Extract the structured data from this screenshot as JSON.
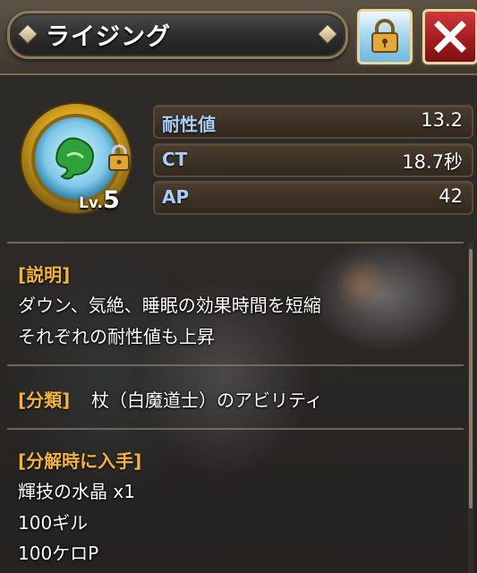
{
  "header": {
    "title": "ライジング"
  },
  "ability": {
    "level_prefix": "Lv.",
    "level": "5",
    "locked": true
  },
  "stats": [
    {
      "label": "耐性値",
      "value": "13.2"
    },
    {
      "label": "CT",
      "value": "18.7秒"
    },
    {
      "label": "AP",
      "value": "42"
    }
  ],
  "sections": {
    "description": {
      "heading": "[説明]",
      "lines": [
        "ダウン、気絶、睡眠の効果時間を短縮",
        "それぞれの耐性値も上昇"
      ]
    },
    "category": {
      "heading": "[分類]",
      "value": "杖（白魔道士）のアビリティ"
    },
    "decompose": {
      "heading": "[分解時に入手]",
      "items": [
        "輝技の水晶 x1",
        "100ギル",
        "100ケロP"
      ]
    }
  },
  "colors": {
    "section_heading": "#f2b23e",
    "stat_label": "#a9cdf5",
    "close_button": "#b0222a",
    "lock_button": "#a8d8f0"
  },
  "icons": {
    "lock": "lock-icon",
    "close": "close-icon",
    "ability": "wind-ability-icon"
  }
}
